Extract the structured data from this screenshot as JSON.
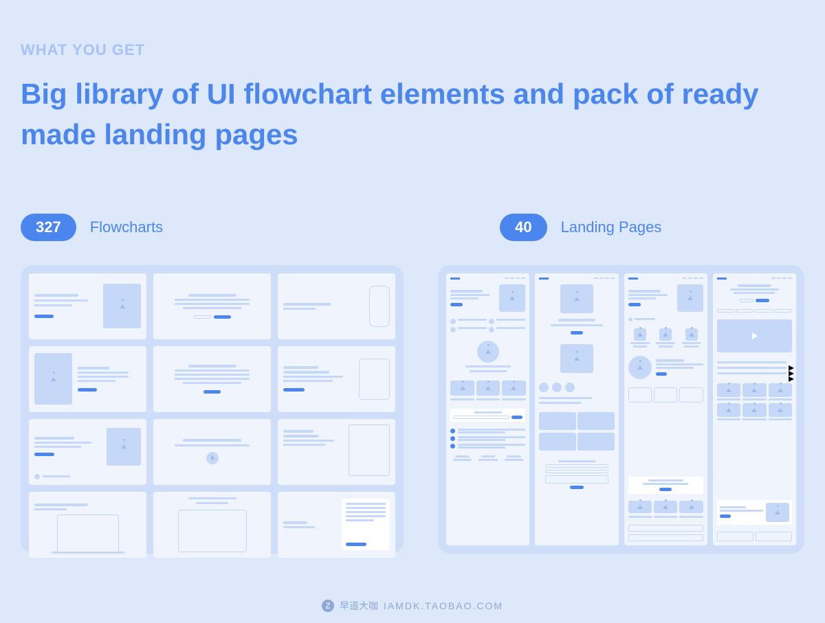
{
  "eyebrow": "WHAT YOU GET",
  "headline": "Big library of UI flowchart elements and pack of ready made landing pages",
  "stats": {
    "flowcharts": {
      "count": "327",
      "label": "Flowcharts"
    },
    "landing": {
      "count": "40",
      "label": "Landing Pages"
    }
  },
  "watermark": {
    "brand": "早道大咖",
    "url": "IAMDK.TAOBAO.COM"
  },
  "colors": {
    "background": "#dde8fb",
    "accent": "#4b86ef",
    "light_accent": "#a8c2f5",
    "card_bg": "#cedef9",
    "inner_card": "#f0f5fd",
    "placeholder": "#c6d8f7"
  }
}
